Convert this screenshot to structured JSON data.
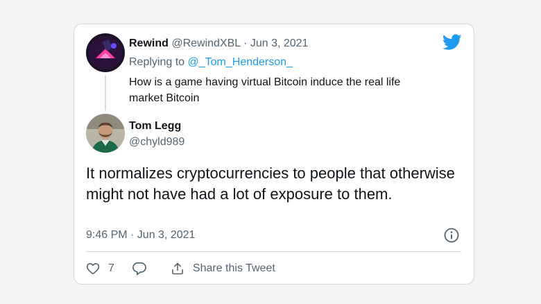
{
  "reply_tweet": {
    "author_name": "Rewind",
    "author_handle": "@RewindXBL",
    "separator": "·",
    "date": "Jun 3, 2021",
    "replying_prefix": "Replying to",
    "replying_to": "@_Tom_Henderson_",
    "text": "How is a game having virtual Bitcoin induce the real life market Bitcoin"
  },
  "main_tweet": {
    "author_name": "Tom Legg",
    "author_handle": "@chyld989",
    "text": "It normalizes cryptocurrencies to people that otherwise might not have had a lot of exposure to them.",
    "timestamp": "9:46 PM · Jun 3, 2021"
  },
  "actions": {
    "like_count": "7",
    "share_label": "Share this Tweet"
  },
  "icons": {
    "brand": "twitter-bird-icon",
    "info": "info-icon",
    "like": "heart-icon",
    "reply": "speech-bubble-icon",
    "share": "share-icon"
  },
  "colors": {
    "brand_blue": "#1d9bf0",
    "text_primary": "#0f1419",
    "text_secondary": "#536471",
    "border": "#cfd9de",
    "page_background": "#f4f4f4"
  }
}
